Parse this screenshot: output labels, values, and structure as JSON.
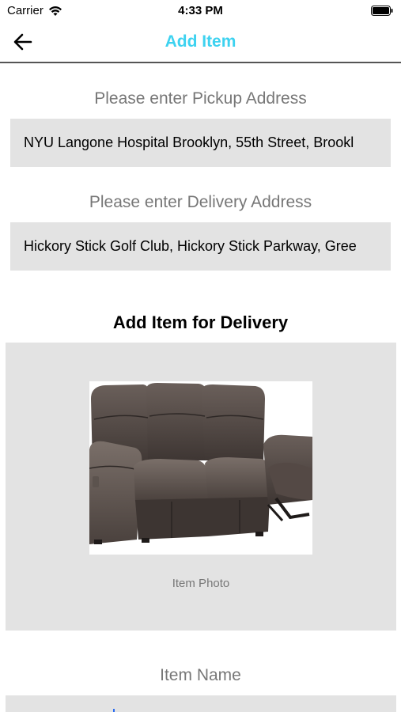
{
  "status_bar": {
    "carrier": "Carrier",
    "time": "4:33 PM",
    "wifi_icon": "wifi-icon",
    "battery_icon": "battery-icon"
  },
  "nav": {
    "title": "Add Item",
    "title_color": "#3dd2f0",
    "back_icon": "arrow-left-icon"
  },
  "pickup": {
    "label": "Please enter Pickup Address",
    "value": "NYU Langone Hospital Brooklyn, 55th Street, Brookl"
  },
  "delivery": {
    "label": "Please enter Delivery Address",
    "value": "Hickory Stick Golf Club, Hickory Stick Parkway, Gree"
  },
  "item_section": {
    "heading": "Add Item for Delivery",
    "photo_caption": "Item Photo",
    "photo_subject": "sofa-image"
  },
  "item_name": {
    "label": "Item Name",
    "value": ""
  },
  "colors": {
    "field_background": "#e3e3e3",
    "label_gray": "#777777"
  }
}
